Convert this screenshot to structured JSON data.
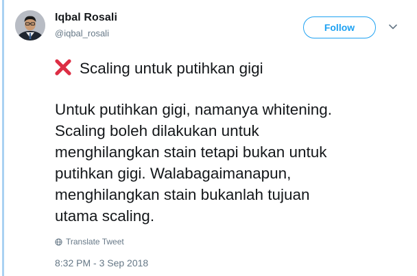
{
  "user": {
    "name": "Iqbal Rosali",
    "handle": "@iqbal_rosali"
  },
  "follow_label": "Follow",
  "tweet": {
    "headline": "Scaling untuk putihkan gigi",
    "lines": [
      "Untuk putihkan gigi, namanya whitening.",
      "Scaling boleh dilakukan untuk",
      "menghilangkan stain tetapi bukan untuk",
      "putihkan gigi. Walabagaimanapun,",
      "menghilangkan stain bukanlah tujuan",
      "utama scaling."
    ]
  },
  "translate_label": "Translate Tweet",
  "timestamp": "8:32 PM - 3 Sep 2018",
  "icons": {
    "headline_icon": "cross-mark-icon",
    "translate_icon": "globe-icon",
    "menu_icon": "chevron-down-icon"
  },
  "colors": {
    "accent": "#1da1f2",
    "thread_line": "#a9d1f2",
    "cross": "#dd2e44",
    "muted": "#657786"
  }
}
